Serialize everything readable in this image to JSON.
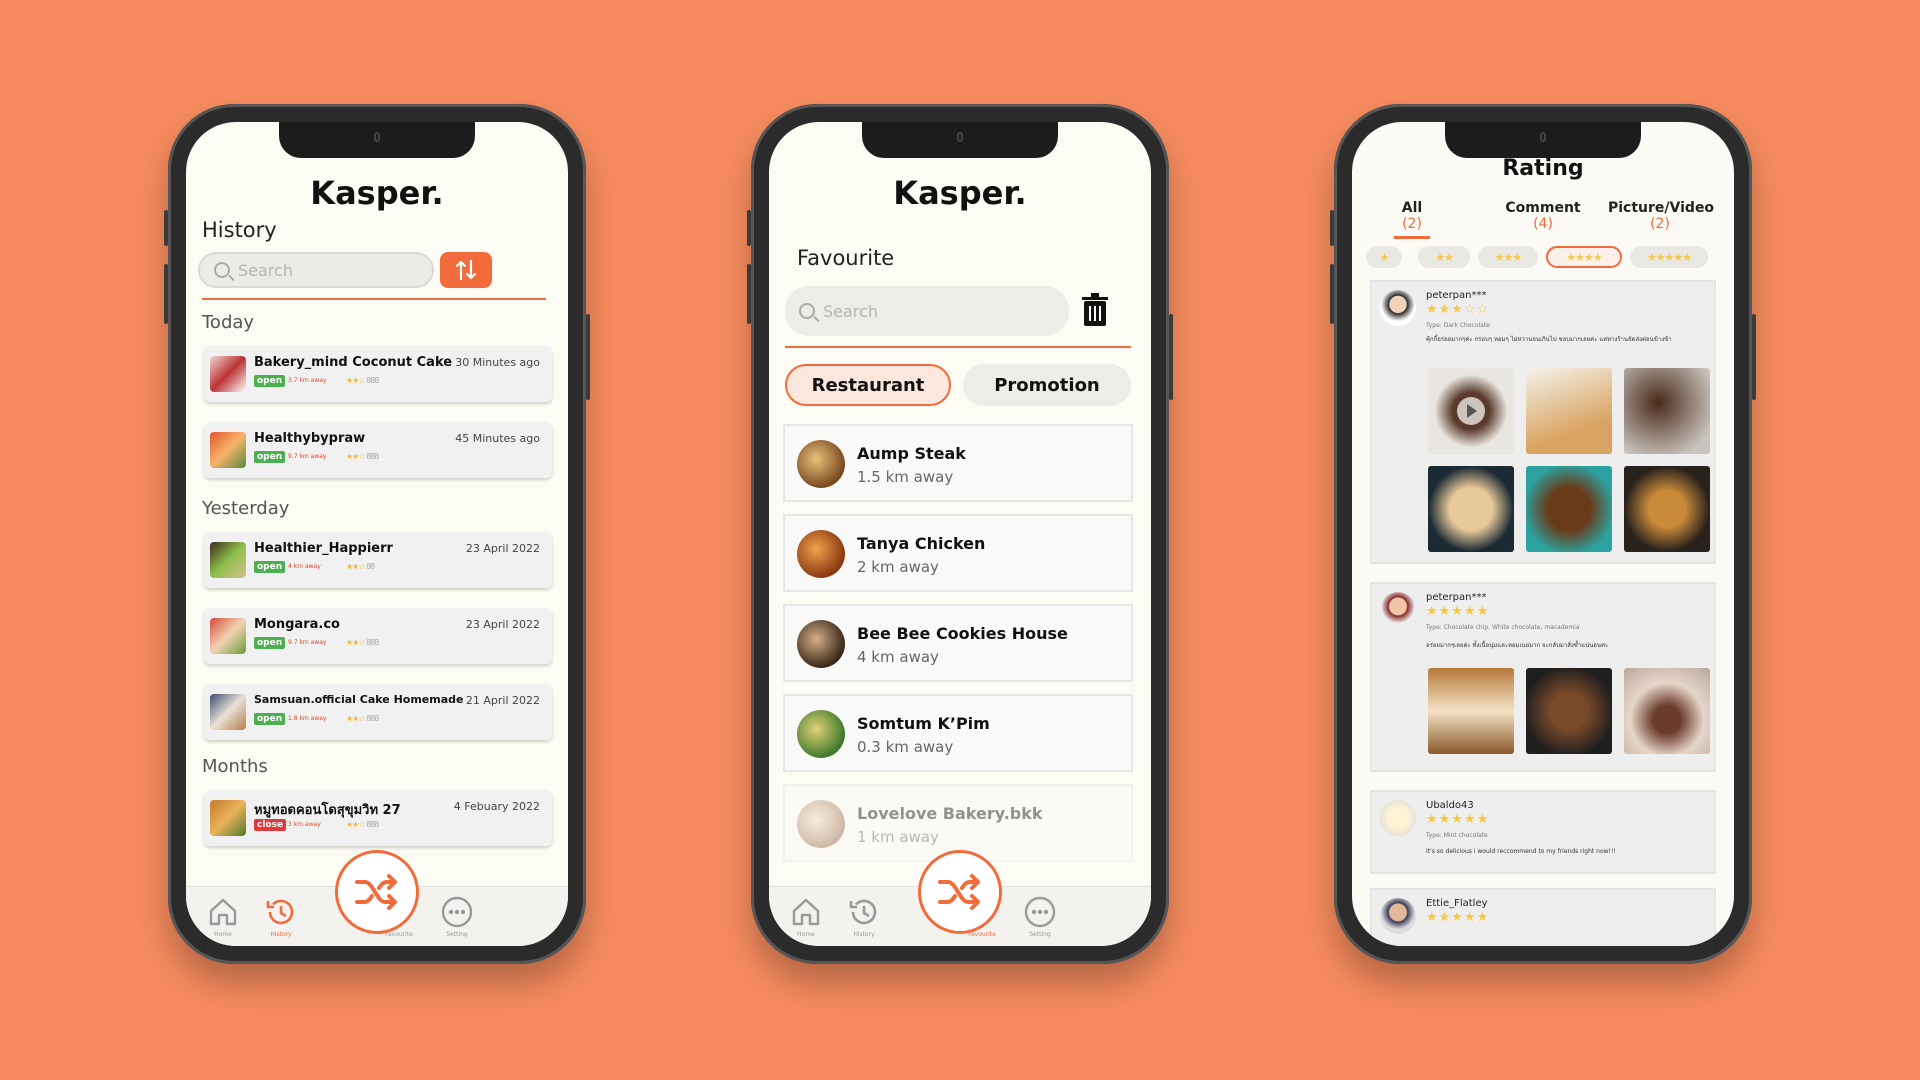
{
  "colors": {
    "background": "#F58B5E",
    "accent": "#F26B3A",
    "open": "#4CB050",
    "close": "#E03A3A",
    "star": "#F5C84B"
  },
  "phone1": {
    "brand": "Kasper.",
    "section": "History",
    "search_placeholder": "Search",
    "groups": [
      "Today",
      "Yesterday",
      "Months"
    ],
    "items": [
      {
        "name": "Bakery_mind Coconut Cake",
        "time": "30 Minutes ago",
        "status": "open",
        "dist": "3.7 km away",
        "rating": "888"
      },
      {
        "name": "Healthybypraw",
        "time": "45 Minutes ago",
        "status": "open",
        "dist": "9.7 km away",
        "rating": "888"
      },
      {
        "name": "Healthier_Happierr",
        "time": "23 April 2022",
        "status": "open",
        "dist": "4 km away",
        "rating": "88"
      },
      {
        "name": "Mongara.co",
        "time": "23 April 2022",
        "status": "open",
        "dist": "9.7 km away",
        "rating": "888"
      },
      {
        "name": "Samsuan.official Cake Homemade",
        "time": "21 April 2022",
        "status": "open",
        "dist": "1.8 km away",
        "rating": "888"
      },
      {
        "name": "หมูทอดคอนโดสุขุมวิท 27",
        "time": "4 Febuary 2022",
        "status": "close",
        "dist": "3 km away",
        "rating": "888"
      }
    ],
    "nav": [
      "Home",
      "History",
      "Favourite",
      "Setting"
    ]
  },
  "phone2": {
    "brand": "Kasper.",
    "section": "Favourite",
    "search_placeholder": "Search",
    "tabs": [
      "Restaurant",
      "Promotion"
    ],
    "items": [
      {
        "name": "Aump Steak",
        "dist": "1.5 km away"
      },
      {
        "name": "Tanya Chicken",
        "dist": "2 km away"
      },
      {
        "name": "Bee Bee Cookies House",
        "dist": "4 km away"
      },
      {
        "name": "Somtum K’Pim",
        "dist": "0.3 km away"
      },
      {
        "name": "Lovelove Bakery.bkk",
        "dist": "1 km away"
      }
    ],
    "nav": [
      "Home",
      "History",
      "Favourite",
      "Setting"
    ]
  },
  "phone3": {
    "title": "Rating",
    "tabs": [
      {
        "label": "All",
        "count": "(2)"
      },
      {
        "label": "Comment",
        "count": "(4)"
      },
      {
        "label": "Picture/Video",
        "count": "(2)"
      }
    ],
    "star_filters": [
      "★",
      "★★",
      "★★★",
      "★★★★",
      "★★★★★"
    ],
    "reviews": [
      {
        "user": "peterpan***",
        "stars": "★★★☆☆",
        "type": "Type: Dark Chocolate",
        "text": "คุ้กกี้อร่อยมากๆค่ะ กรอบๆ หอมๆ ไม่หวานจนเกินไป ชอบมากเลยค่ะ แต่ทางร้านจัดส่งค่อนข้างช้า"
      },
      {
        "user": "peterpan***",
        "stars": "★★★★★",
        "type": "Type: Chocolate chip, White chocolate, macademia",
        "text": "อร่อยมากๆเลยค่ะ ทั้งเนื้อนุ่มและหอมเนยมาก จะกลับมาสั่งซ้ำแน่นอนค่ะ"
      },
      {
        "user": "Ubaldo43",
        "stars": "★★★★★",
        "type": "Type: Mint chocolate",
        "text": "It's so delicious i would reccommend to my friends right now!!!"
      },
      {
        "user": "Ettie_Flatley",
        "stars": "★★★★★"
      }
    ]
  }
}
